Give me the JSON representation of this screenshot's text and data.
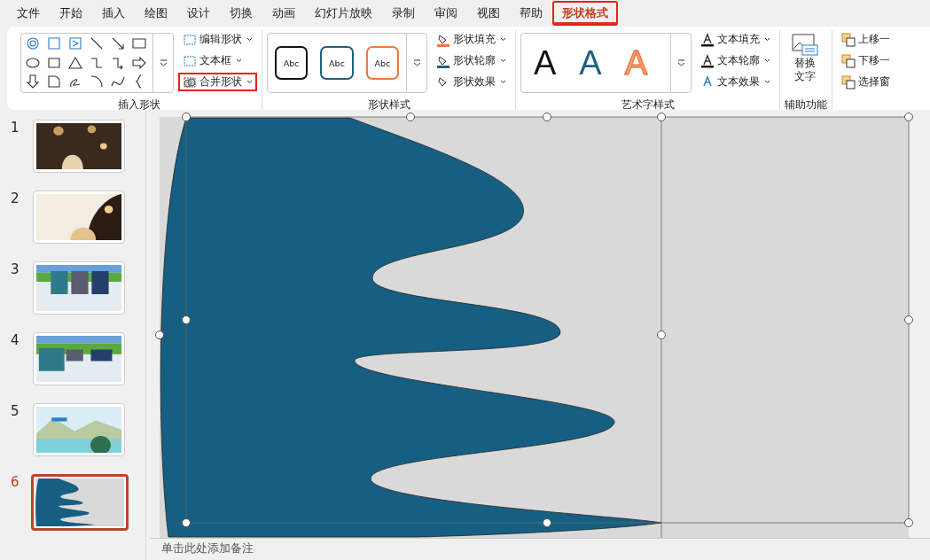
{
  "tabs": [
    {
      "label": "文件",
      "selected": false,
      "highlighted": false
    },
    {
      "label": "开始",
      "selected": false,
      "highlighted": false
    },
    {
      "label": "插入",
      "selected": false,
      "highlighted": false
    },
    {
      "label": "绘图",
      "selected": false,
      "highlighted": false
    },
    {
      "label": "设计",
      "selected": false,
      "highlighted": false
    },
    {
      "label": "切换",
      "selected": false,
      "highlighted": false
    },
    {
      "label": "动画",
      "selected": false,
      "highlighted": false
    },
    {
      "label": "幻灯片放映",
      "selected": false,
      "highlighted": false
    },
    {
      "label": "录制",
      "selected": false,
      "highlighted": false
    },
    {
      "label": "审阅",
      "selected": false,
      "highlighted": false
    },
    {
      "label": "视图",
      "selected": false,
      "highlighted": false
    },
    {
      "label": "帮助",
      "selected": false,
      "highlighted": false
    },
    {
      "label": "形状格式",
      "selected": true,
      "highlighted": true
    }
  ],
  "ribbon": {
    "insert_shapes": {
      "label": "插入形状",
      "commands": [
        {
          "label": "编辑形状",
          "highlighted": false
        },
        {
          "label": "文本框",
          "highlighted": false
        },
        {
          "label": "合并形状",
          "highlighted": true
        }
      ]
    },
    "shape_styles": {
      "label": "形状样式",
      "presets": [
        {
          "label": "Abc",
          "color": "#111111"
        },
        {
          "label": "Abc",
          "color": "#1f6080"
        },
        {
          "label": "Abc",
          "color": "#e97a3c"
        }
      ],
      "commands": [
        {
          "label": "形状填充"
        },
        {
          "label": "形状轮廓"
        },
        {
          "label": "形状效果"
        }
      ]
    },
    "wordart_styles": {
      "label": "艺术字样式",
      "presets": [
        {
          "label": "A",
          "color": "#111111"
        },
        {
          "label": "A",
          "color": "#1f6080"
        },
        {
          "label": "A",
          "color": "#f4a37b"
        }
      ],
      "commands": [
        {
          "label": "文本填充"
        },
        {
          "label": "文本轮廓"
        },
        {
          "label": "文本效果"
        }
      ]
    },
    "accessibility": {
      "label": "辅助功能",
      "button": "替换文字"
    },
    "arrange": {
      "commands": [
        {
          "label": "上移一"
        },
        {
          "label": "下移一"
        },
        {
          "label": "选择窗"
        }
      ]
    }
  },
  "slides": [
    {
      "number": "1",
      "selected": false,
      "kind": "picture"
    },
    {
      "number": "2",
      "selected": false,
      "kind": "picture"
    },
    {
      "number": "3",
      "selected": false,
      "kind": "picture"
    },
    {
      "number": "4",
      "selected": false,
      "kind": "picture"
    },
    {
      "number": "5",
      "selected": false,
      "kind": "picture"
    },
    {
      "number": "6",
      "selected": true,
      "kind": "shape"
    }
  ],
  "notes": {
    "placeholder": "单击此处添加备注"
  }
}
